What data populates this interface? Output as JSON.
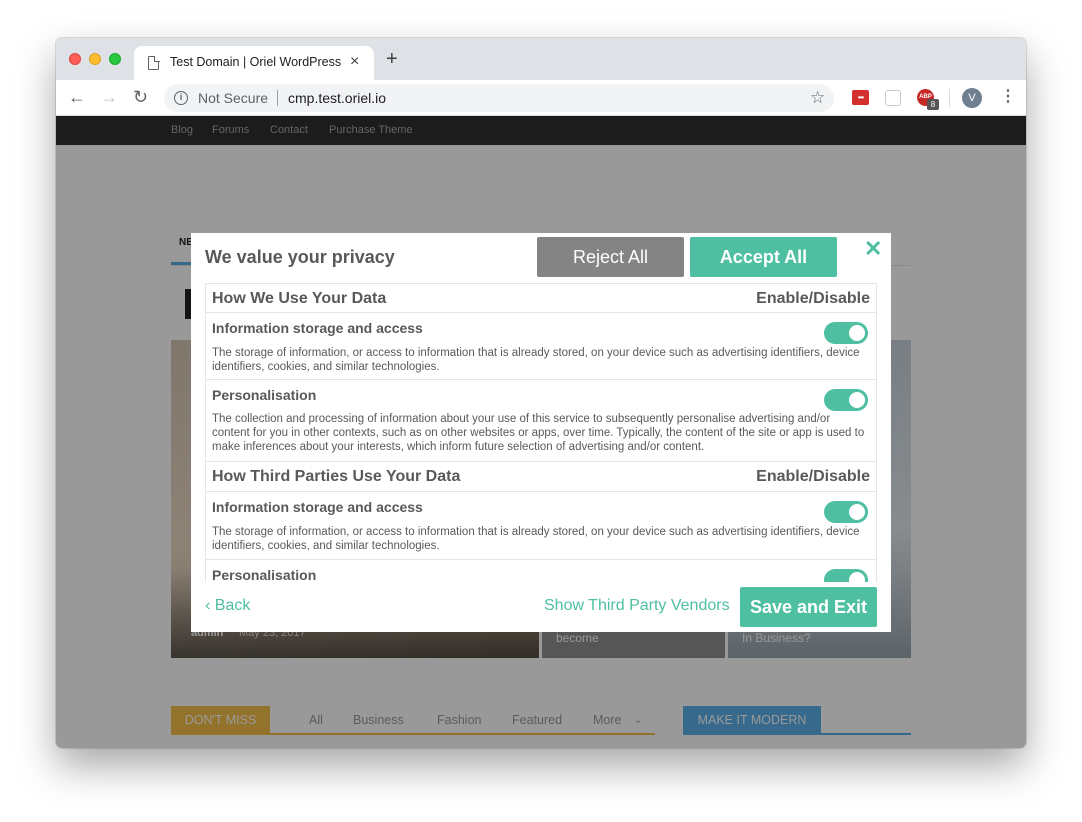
{
  "browser": {
    "tab_title": "Test Domain | Oriel WordPress",
    "tab_close": "×",
    "new_tab": "+",
    "security_label": "Not Secure",
    "url": "cmp.test.oriel.io",
    "avatar_initial": "V",
    "ext_badge_count": "8",
    "icons": [
      "page-icon",
      "back-icon",
      "forward-icon",
      "reload-icon",
      "info-icon",
      "star-icon",
      "lastpass-icon",
      "extension-icon",
      "adblock-icon",
      "menu-icon"
    ]
  },
  "site": {
    "topnav": [
      "Blog",
      "Forums",
      "Contact",
      "Purchase Theme"
    ],
    "secnav_label": "NE",
    "hero_left_author": "admin",
    "hero_left_date": "May 23, 2017",
    "hero_mid_text": "become",
    "hero_right_text": "In Business?",
    "dont_miss": "DON'T MISS",
    "filters": [
      "All",
      "Business",
      "Fashion",
      "Featured",
      "More"
    ],
    "make_modern": "MAKE IT MODERN"
  },
  "modal": {
    "title": "We value your privacy",
    "reject_label": "Reject All",
    "accept_label": "Accept All",
    "close_label": "✕",
    "sections": [
      {
        "title": "How We Use Your Data",
        "right_label": "Enable/Disable",
        "purposes": [
          {
            "title": "Information storage and access",
            "desc": "The storage of information, or access to information that is already stored, on your device such as advertising identifiers, device identifiers, cookies, and similar technologies.",
            "enabled": true
          },
          {
            "title": "Personalisation",
            "desc": "The collection and processing of information about your use of this service to subsequently personalise advertising and/or content for you in other contexts, such as on other websites or apps, over time. Typically, the content of the site or app is used to make inferences about your interests, which inform future selection of advertising and/or content.",
            "enabled": true
          }
        ]
      },
      {
        "title": "How Third Parties Use Your Data",
        "right_label": "Enable/Disable",
        "purposes": [
          {
            "title": "Information storage and access",
            "desc": "The storage of information, or access to information that is already stored, on your device such as advertising identifiers, device identifiers, cookies, and similar technologies.",
            "enabled": true
          },
          {
            "title": "Personalisation",
            "desc": "",
            "enabled": true
          }
        ]
      }
    ],
    "back_label": "‹ Back",
    "vendors_label": "Show Third Party Vendors",
    "save_label": "Save and Exit"
  },
  "colors": {
    "accent": "#4ebfa1",
    "reject_gray": "#848484",
    "text_gray": "#595959"
  }
}
